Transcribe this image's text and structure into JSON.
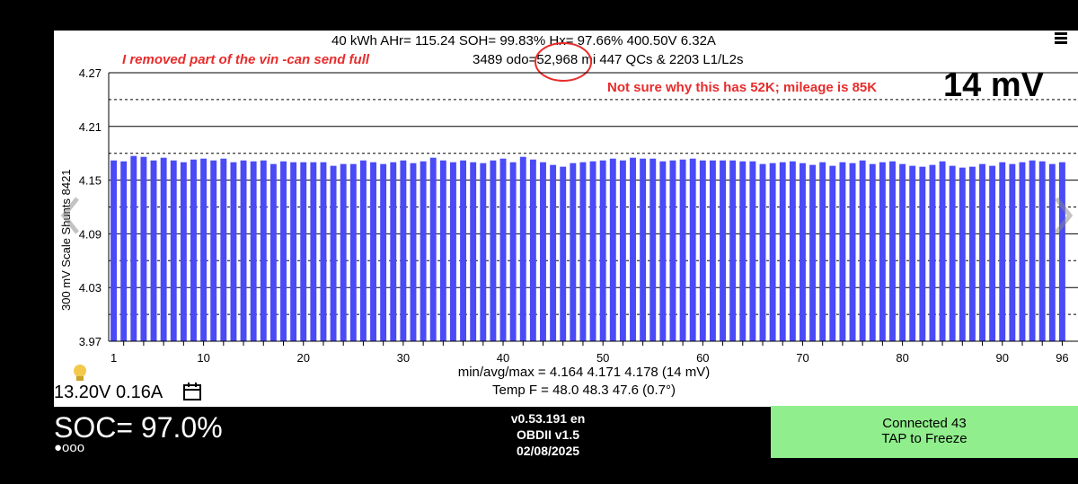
{
  "header": {
    "line1": "40 kWh  AHr= 115.24  SOH= 99.83%   Hx= 97.66%   400.50V 6.32A",
    "line2": "3489 odo=52,968 mi  447 QCs & 2203 L1/L2s"
  },
  "annotations": {
    "vin_note": "I removed part of the vin -can send full",
    "mileage_note": "Not sure why this has 52K; mileage is 85K"
  },
  "delta_display": "14 mV",
  "colors": {
    "bars": "#4a4af7",
    "annotation": "#e82c2c",
    "connect_bg": "#90ee8c"
  },
  "stats": {
    "minavgmax": "min/avg/max = 4.164 4.171 4.178  (14 mV)",
    "temp": "Temp F = 48.0  48.3  47.6  (0.7°)"
  },
  "aux": {
    "voltage_current": "13.20V 0.16A",
    "bulb_icon": "bulb-icon",
    "calendar_icon": "calendar-icon"
  },
  "soc": {
    "label": "SOC= 97.0%",
    "dots": "●ooo"
  },
  "version": {
    "app": "v0.53.191 en",
    "obd": "OBDII  v1.5",
    "date": "02/08/2025"
  },
  "connect": {
    "line1": "Connected 43",
    "line2": "TAP to Freeze"
  },
  "chart_data": {
    "type": "bar",
    "ylabel": "300 mV Scale  Shunts 8421",
    "ylim": [
      3.97,
      4.27
    ],
    "yticks": [
      "4.27",
      "4.21",
      "4.15",
      "4.09",
      "4.03",
      "3.97"
    ],
    "xticks": [
      "1",
      "10",
      "20",
      "30",
      "40",
      "50",
      "60",
      "70",
      "80",
      "90",
      "96"
    ],
    "grid": true,
    "x": [
      1,
      2,
      3,
      4,
      5,
      6,
      7,
      8,
      9,
      10,
      11,
      12,
      13,
      14,
      15,
      16,
      17,
      18,
      19,
      20,
      21,
      22,
      23,
      24,
      25,
      26,
      27,
      28,
      29,
      30,
      31,
      32,
      33,
      34,
      35,
      36,
      37,
      38,
      39,
      40,
      41,
      42,
      43,
      44,
      45,
      46,
      47,
      48,
      49,
      50,
      51,
      52,
      53,
      54,
      55,
      56,
      57,
      58,
      59,
      60,
      61,
      62,
      63,
      64,
      65,
      66,
      67,
      68,
      69,
      70,
      71,
      72,
      73,
      74,
      75,
      76,
      77,
      78,
      79,
      80,
      81,
      82,
      83,
      84,
      85,
      86,
      87,
      88,
      89,
      90,
      91,
      92,
      93,
      94,
      95,
      96
    ],
    "values": [
      4.172,
      4.171,
      4.177,
      4.176,
      4.172,
      4.175,
      4.172,
      4.17,
      4.173,
      4.174,
      4.172,
      4.174,
      4.17,
      4.172,
      4.171,
      4.172,
      4.168,
      4.171,
      4.17,
      4.17,
      4.17,
      4.17,
      4.166,
      4.168,
      4.168,
      4.172,
      4.17,
      4.168,
      4.17,
      4.172,
      4.169,
      4.171,
      4.175,
      4.172,
      4.17,
      4.172,
      4.17,
      4.169,
      4.172,
      4.174,
      4.17,
      4.176,
      4.173,
      4.17,
      4.167,
      4.165,
      4.169,
      4.17,
      4.171,
      4.172,
      4.174,
      4.172,
      4.175,
      4.174,
      4.174,
      4.171,
      4.172,
      4.173,
      4.174,
      4.172,
      4.172,
      4.172,
      4.172,
      4.171,
      4.171,
      4.168,
      4.169,
      4.17,
      4.171,
      4.169,
      4.167,
      4.17,
      4.166,
      4.17,
      4.169,
      4.172,
      4.168,
      4.17,
      4.171,
      4.168,
      4.166,
      4.165,
      4.167,
      4.171,
      4.166,
      4.164,
      4.165,
      4.168,
      4.166,
      4.17,
      4.168,
      4.17,
      4.172,
      4.171,
      4.168,
      4.17
    ]
  }
}
